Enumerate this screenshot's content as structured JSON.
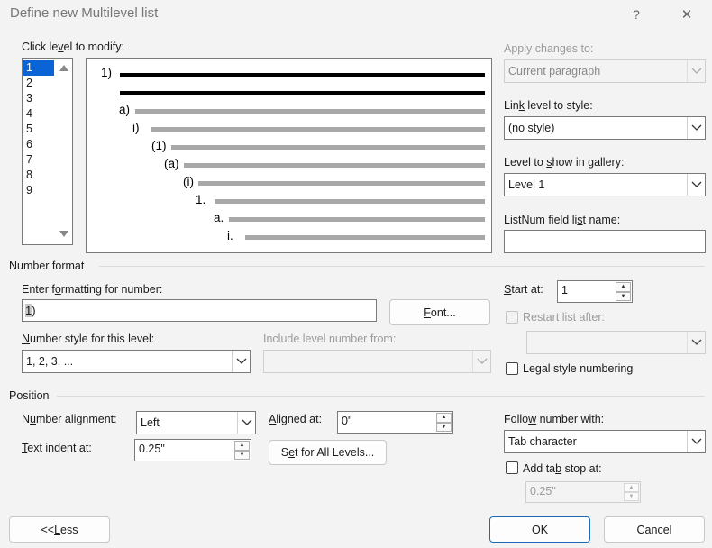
{
  "dialog": {
    "title": "Define new Multilevel list",
    "help_glyph": "?",
    "close_glyph": "✕"
  },
  "levels": {
    "label_pre": "Click le",
    "label_u": "v",
    "label_post": "el to modify:",
    "items": [
      "1",
      "2",
      "3",
      "4",
      "5",
      "6",
      "7",
      "8",
      "9"
    ],
    "selected": "1"
  },
  "preview": {
    "labels": [
      "1)",
      "a)",
      "i)",
      "(1)",
      "(a)",
      "(i)",
      "1.",
      "a.",
      "i."
    ]
  },
  "apply_changes": {
    "label": "Apply changes to:",
    "value": "Current paragraph"
  },
  "link_level": {
    "label_pre": "Lin",
    "label_u": "k",
    "label_post": " level to style:",
    "value": "(no style)"
  },
  "gallery_level": {
    "label_pre": "Level to ",
    "label_u": "s",
    "label_post": "how in gallery:",
    "value": "Level 1"
  },
  "listnum": {
    "label_pre": "ListNum field li",
    "label_u": "s",
    "label_post": "t name:",
    "value": ""
  },
  "number_format": {
    "section": "Number format",
    "enter_label_pre": "Enter f",
    "enter_label_u": "o",
    "enter_label_post": "rmatting for number:",
    "format_value_hl": "1",
    "format_value_rest": ")",
    "font_button_pre": "",
    "font_button_u": "F",
    "font_button_post": "ont...",
    "style_label_pre": "",
    "style_label_u": "N",
    "style_label_post": "umber style for this level:",
    "style_value": "1, 2, 3, ...",
    "include_label": "Include level number from:",
    "include_value": "",
    "start_label_pre": "",
    "start_label_u": "S",
    "start_label_post": "tart at:",
    "start_value": "1",
    "restart_label": "Restart list after:",
    "restart_value": "",
    "legal_label_pre": "Le",
    "legal_label_u": "g",
    "legal_label_post": "al style numbering"
  },
  "position": {
    "section": "Position",
    "align_label_pre": "N",
    "align_label_u": "u",
    "align_label_post": "mber alignment:",
    "align_value": "Left",
    "aligned_at_label_pre": "",
    "aligned_at_label_u": "A",
    "aligned_at_label_post": "ligned at:",
    "aligned_at_value": "0\"",
    "indent_label_pre": "",
    "indent_label_u": "T",
    "indent_label_post": "ext indent at:",
    "indent_value": "0.25\"",
    "set_all_pre": "S",
    "set_all_u": "e",
    "set_all_post": "t for All Levels...",
    "follow_label_pre": "Follo",
    "follow_label_u": "w",
    "follow_label_post": " number with:",
    "follow_value": "Tab character",
    "tab_stop_label_pre": "Add ta",
    "tab_stop_label_u": "b",
    "tab_stop_label_post": " stop at:",
    "tab_stop_value": "0.25\""
  },
  "footer": {
    "less_pre": "<< ",
    "less_u": "L",
    "less_post": "ess",
    "ok": "OK",
    "cancel": "Cancel"
  }
}
